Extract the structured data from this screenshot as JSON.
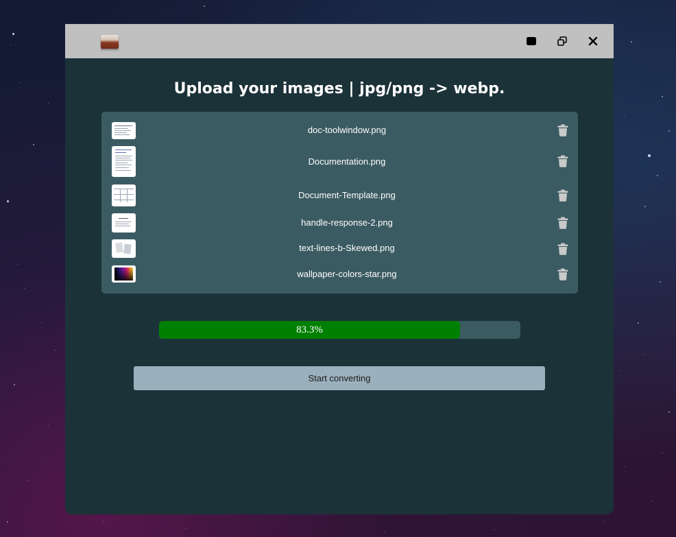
{
  "window": {
    "title_icon": "image-app-icon",
    "controls": [
      "minimize-icon",
      "restore-icon",
      "close-icon"
    ]
  },
  "heading": "Upload your images | jpg/png -> webp.",
  "files": [
    {
      "name": "doc-toolwindow.png",
      "thumb_icon": "document-thumbnail"
    },
    {
      "name": "Documentation.png",
      "thumb_icon": "document-thumbnail"
    },
    {
      "name": "Document-Template.png",
      "thumb_icon": "document-thumbnail"
    },
    {
      "name": "handle-response-2.png",
      "thumb_icon": "document-thumbnail"
    },
    {
      "name": "text-lines-b-Skewed.png",
      "thumb_icon": "document-thumbnail"
    },
    {
      "name": "wallpaper-colors-star.png",
      "thumb_icon": "color-wallpaper-thumbnail"
    }
  ],
  "progress": {
    "value": 0.833,
    "label": "83.3%"
  },
  "start_button": "Start converting",
  "colors": {
    "window_bg": "#1c3239",
    "titlebar": "#c0c0c0",
    "list_bg": "#3b5b62",
    "progress_fill": "#008000",
    "button_bg": "#9bb0bd"
  }
}
